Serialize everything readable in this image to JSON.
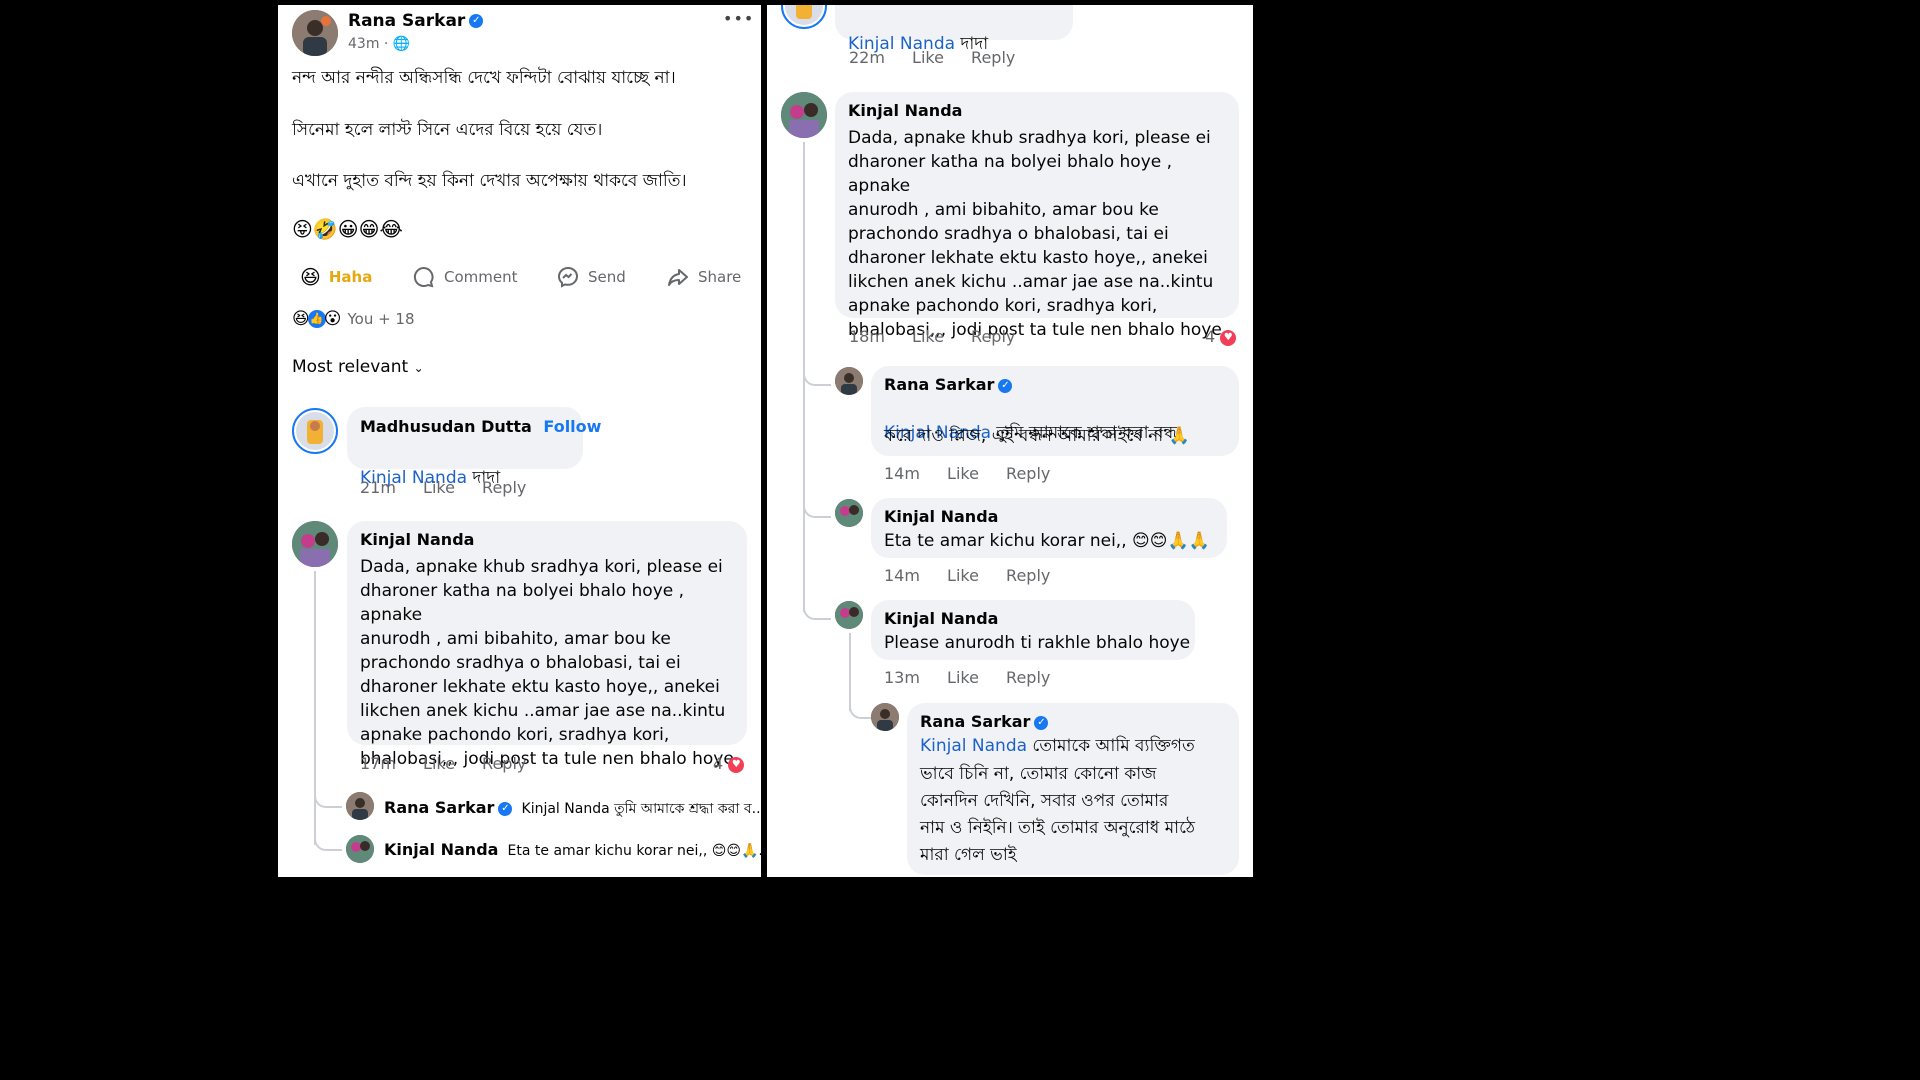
{
  "post": {
    "author": "Rana Sarkar",
    "time": "43m",
    "more": "•••",
    "lines": [
      "নন্দ আর নন্দীর অন্ধিসন্ধি দেখে ফন্দিটা বোঝায় যাচ্ছে না।",
      "সিনেমা হলে লাস্ট সিনে এদের বিয়ে হয়ে যেত।",
      "এখানে দুহাত বন্দি হয় কিনা দেখার অপেক্ষায় থাকবে জাতি।"
    ],
    "emojis": "😝🤣😀😁😂",
    "actions": {
      "haha": "Haha",
      "comment": "Comment",
      "send": "Send",
      "share": "Share"
    },
    "reactions_summary": "You + 18",
    "sort": "Most relevant"
  },
  "left_comments": {
    "c1": {
      "author": "Madhusudan Dutta",
      "follow": "Follow",
      "mention": "Kinjal Nanda",
      "text": " দাদা",
      "time": "21m",
      "like": "Like",
      "reply": "Reply"
    },
    "c2": {
      "author": "Kinjal Nanda",
      "text": "Dada, apnake khub sradhya kori, please ei\ndharoner katha na bolyei bhalo hoye , apnake\nanurodh , ami  bibahito, amar bou ke\nprachondo sradhya o bhalobasi, tai ei\ndharoner lekhate ektu kasto hoye,, anekei\nlikchen anek kichu ..amar jae ase na..kintu\napnake pachondo kori, sradhya kori,\nbhalobasi,,, jodi post ta tule nen bhalo hoye",
      "time": "17m",
      "like": "Like",
      "reply": "Reply",
      "react_count": "4"
    },
    "r1": {
      "author": "Rana Sarkar",
      "preview": "Kinjal Nanda তুমি আমাকে শ্রদ্ধা করা ব..."
    },
    "r2": {
      "author": "Kinjal Nanda",
      "preview": "Eta te amar kichu korar nei,, 😊😊🙏..."
    }
  },
  "right_comments": {
    "top": {
      "mention": "Kinjal Nanda",
      "text": " দাদা",
      "time": "22m",
      "like": "Like",
      "reply": "Reply"
    },
    "c1": {
      "author": "Kinjal Nanda",
      "text": "Dada, apnake khub sradhya kori, please ei\ndharoner katha na bolyei bhalo hoye , apnake\nanurodh , ami  bibahito, amar bou ke\nprachondo sradhya o bhalobasi, tai ei\ndharoner lekhate ektu kasto hoye,, anekei\nlikchen anek kichu ..amar jae ase na..kintu\napnake pachondo kori, sradhya kori,\nbhalobasi,,, jodi post ta tule nen bhalo hoye",
      "time": "18m",
      "like": "Like",
      "reply": "Reply",
      "react_count": "4"
    },
    "r1": {
      "author": "Rana Sarkar",
      "mention": "Kinjal Nanda",
      "line1": " তুমি আমাকে শ্রদ্ধা করা বন্ধ",
      "line2": "করে দাও প্লিজ, এই বন্ধন আমার সইবে না 🙏",
      "time": "14m",
      "like": "Like",
      "reply": "Reply"
    },
    "r2": {
      "author": "Kinjal Nanda",
      "text": "Eta te amar kichu korar nei,, 😊😊🙏🙏",
      "time": "14m",
      "like": "Like",
      "reply": "Reply"
    },
    "r3": {
      "author": "Kinjal Nanda",
      "text": "Please anurodh ti rakhle bhalo hoye",
      "time": "13m",
      "like": "Like",
      "reply": "Reply"
    },
    "r4": {
      "author": "Rana Sarkar",
      "mention": "Kinjal Nanda",
      "line1": " তোমাকে আমি ব্যক্তিগত",
      "rest": "ভাবে চিনি না, তোমার কোনো কাজ\nকোনদিন দেখিনি, সবার ওপর তোমার\nনাম ও নিইনি। তাই তোমার অনুরোধ মাঠে\nমারা গেল ভাই"
    }
  },
  "colors": {
    "link": "#1d62c6",
    "haha": "#e6a810",
    "verified": "#1877f2",
    "heart": "#f33e58",
    "bubble": "#f0f2f5"
  }
}
